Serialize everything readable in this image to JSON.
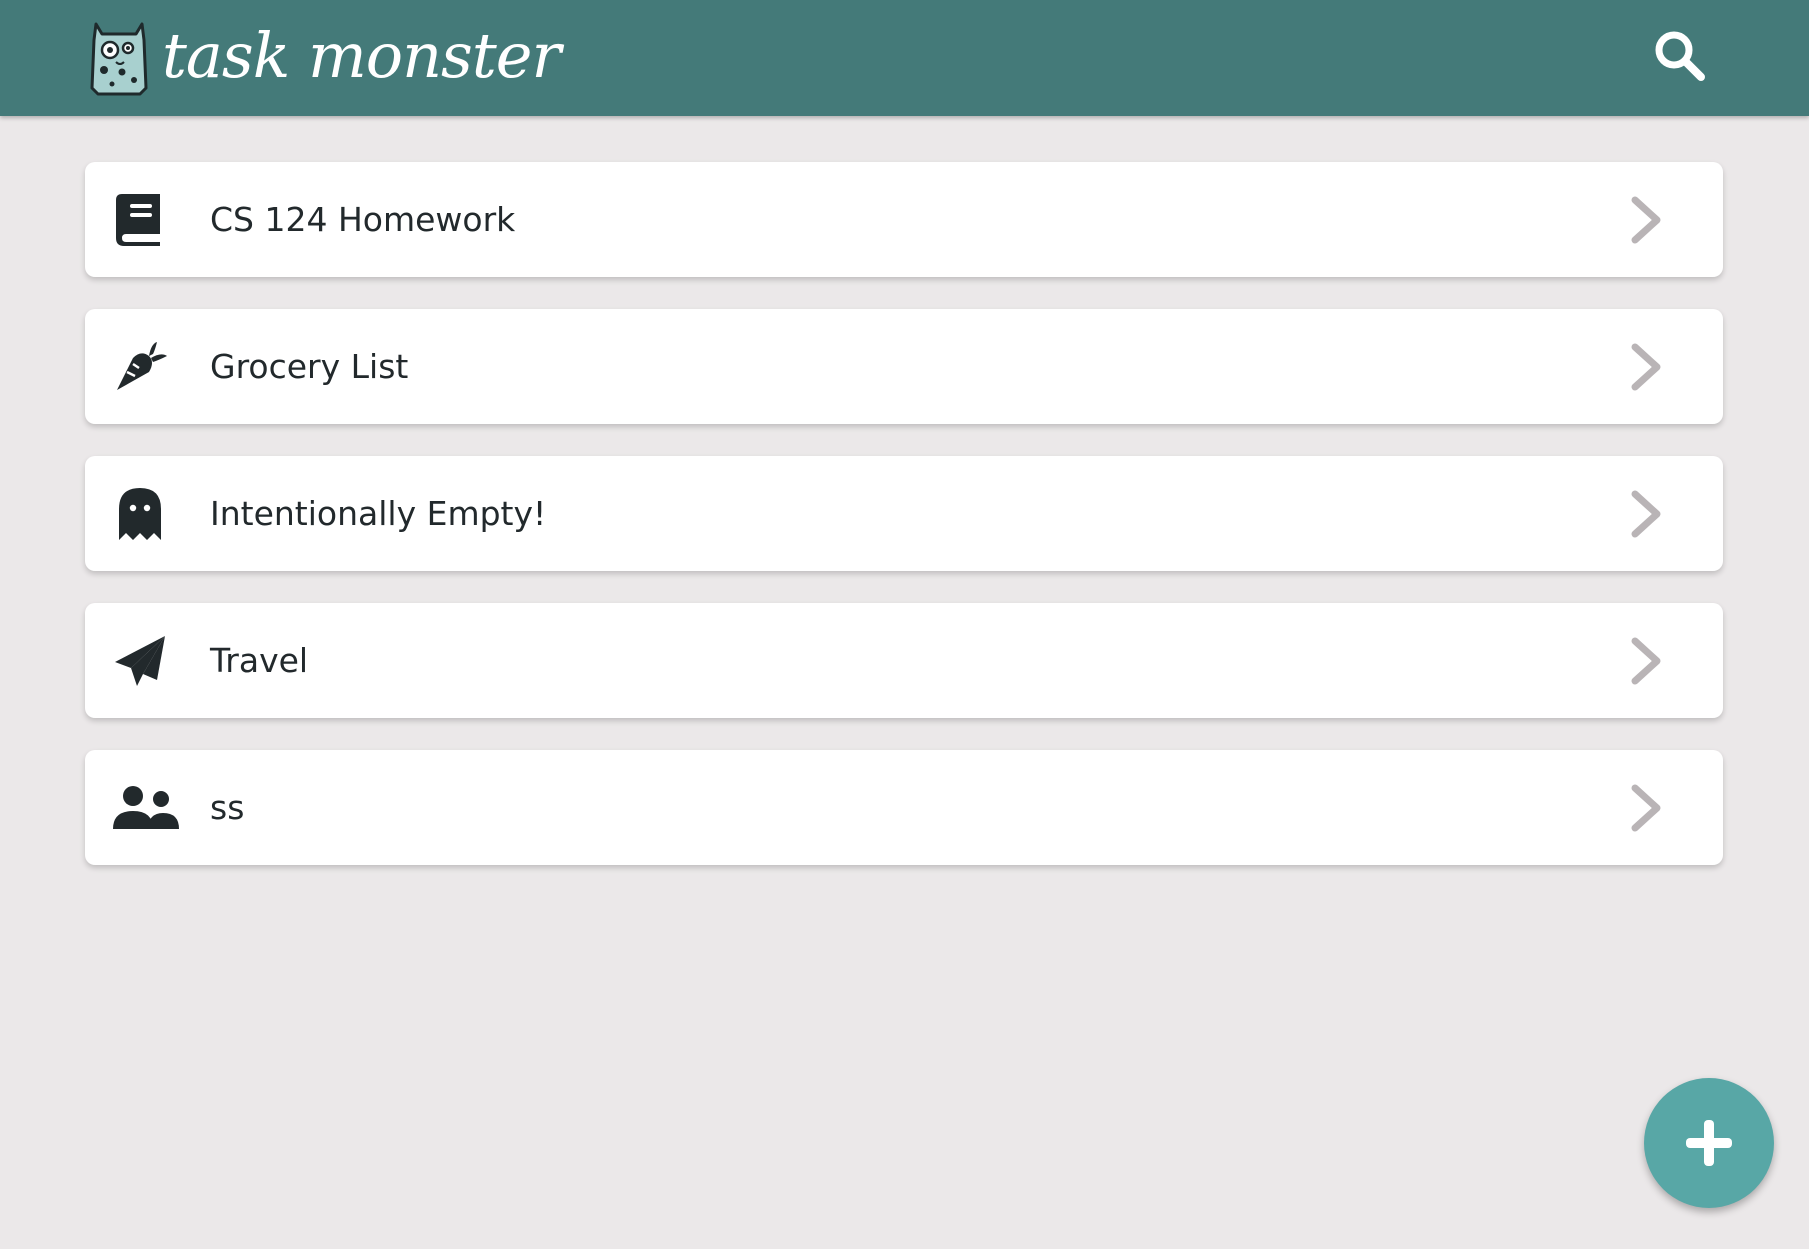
{
  "header": {
    "app_name": "task monster",
    "logo_icon": "monster-logo-icon",
    "search_icon": "search-icon",
    "background_color": "#447a79"
  },
  "lists": [
    {
      "label": "CS 124 Homework",
      "icon": "book-icon"
    },
    {
      "label": "Grocery List",
      "icon": "carrot-icon"
    },
    {
      "label": "Intentionally Empty!",
      "icon": "ghost-icon"
    },
    {
      "label": "Travel",
      "icon": "paper-plane-icon"
    },
    {
      "label": "ss",
      "icon": "users-icon"
    }
  ],
  "fab": {
    "icon": "plus-icon",
    "color": "#58a7a6"
  },
  "colors": {
    "page_background": "#ebe8e9",
    "card_background": "#ffffff",
    "text": "#22292c",
    "chevron": "#b9b4b6"
  }
}
